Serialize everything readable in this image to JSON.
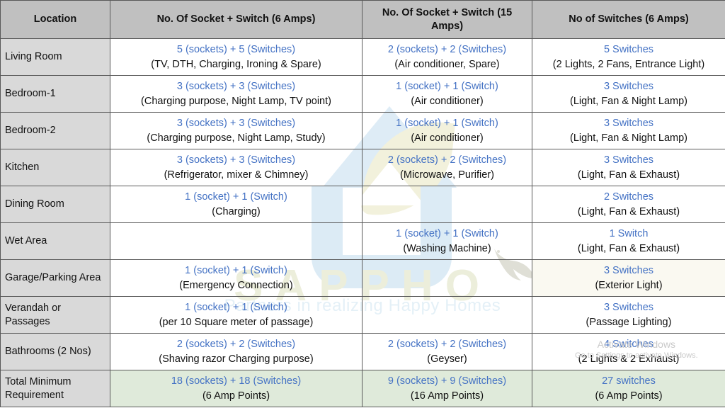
{
  "table": {
    "headers": [
      "Location",
      "No. Of Socket + Switch (6 Amps)",
      "No. Of Socket + Switch (15 Amps)",
      "No of Switches (6 Amps)"
    ],
    "rows": [
      {
        "location": "Living Room",
        "c6amp_count": "5 (sockets) + 5 (Switches)",
        "c6amp_detail": "(TV, DTH, Charging, Ironing & Spare)",
        "c15amp_count": "2 (sockets) + 2 (Switches)",
        "c15amp_detail": "(Air conditioner, Spare)",
        "switches_count": "5 Switches",
        "switches_detail": "(2 Lights, 2 Fans, Entrance Light)"
      },
      {
        "location": "Bedroom-1",
        "c6amp_count": "3 (sockets) + 3 (Switches)",
        "c6amp_detail": "(Charging purpose, Night Lamp, TV point)",
        "c15amp_count": "1 (socket) + 1 (Switch)",
        "c15amp_detail": "(Air conditioner)",
        "switches_count": "3 Switches",
        "switches_detail": "(Light, Fan & Night Lamp)"
      },
      {
        "location": "Bedroom-2",
        "c6amp_count": "3 (sockets) + 3 (Switches)",
        "c6amp_detail": "(Charging purpose, Night Lamp,  Study)",
        "c15amp_count": "1 (socket) + 1 (Switch)",
        "c15amp_detail": "(Air conditioner)",
        "switches_count": "3 Switches",
        "switches_detail": "(Light, Fan & Night Lamp)"
      },
      {
        "location": "Kitchen",
        "c6amp_count": "3 (sockets) + 3 (Switches)",
        "c6amp_detail": "(Refrigerator, mixer & Chimney)",
        "c15amp_count": "2 (sockets) + 2 (Switches)",
        "c15amp_detail": "(Microwave, Purifier)",
        "switches_count": "3 Switches",
        "switches_detail": "(Light, Fan & Exhaust)"
      },
      {
        "location": "Dining Room",
        "c6amp_count": "1 (socket) + 1 (Switch)",
        "c6amp_detail": "(Charging)",
        "c15amp_count": "",
        "c15amp_detail": "",
        "switches_count": "2 Switches",
        "switches_detail": "(Light, Fan & Exhaust)"
      },
      {
        "location": "Wet Area",
        "c6amp_count": "",
        "c6amp_detail": "",
        "c15amp_count": "1 (socket) + 1 (Switch)",
        "c15amp_detail": "(Washing Machine)",
        "switches_count": "1 Switch",
        "switches_detail": "(Light, Fan & Exhaust)"
      },
      {
        "location": "Garage/Parking Area",
        "c6amp_count": "1 (socket) + 1 (Switch)",
        "c6amp_detail": "(Emergency Connection)",
        "c15amp_count": "",
        "c15amp_detail": "",
        "switches_count": "3 Switches",
        "switches_detail": "(Exterior Light)"
      },
      {
        "location": "Verandah or Passages",
        "c6amp_count": "1 (socket) + 1 (Switch)",
        "c6amp_detail": "(per 10 Square meter of passage)",
        "c15amp_count": "",
        "c15amp_detail": "",
        "switches_count": "3 Switches",
        "switches_detail": "(Passage Lighting)"
      },
      {
        "location": "Bathrooms (2 Nos)",
        "c6amp_count": "2 (sockets) + 2 (Switches)",
        "c6amp_detail": "(Shaving razor Charging purpose)",
        "c15amp_count": "2 (sockets) + 2 (Switches)",
        "c15amp_detail": "(Geyser)",
        "switches_count": "4 Switches",
        "switches_detail": "(2 Lights & 2 Exhaust)"
      },
      {
        "location": "Total Minimum Requirement",
        "c6amp_count": "18 (sockets) + 18 (Switches)",
        "c6amp_detail": "(6 Amp Points)",
        "c15amp_count": "9 (sockets) + 9 (Switches)",
        "c15amp_detail": "(16 Amp Points)",
        "switches_count": "27 switches",
        "switches_detail": "(6 Amp Points)"
      }
    ]
  },
  "watermark": {
    "brand": "SAPPHO",
    "tagline": "Partners in realizing Happy Homes"
  },
  "windows_activation": {
    "title": "Activate Windows",
    "subtitle": "Go to Settings to activate Windows."
  },
  "colors": {
    "accent_blue": "#4472c4",
    "header_gray": "#c0c0c0",
    "location_gray": "#d9d9d9",
    "total_green": "#dfeada",
    "tint_cream": "#faf9f1",
    "border": "#595959"
  }
}
